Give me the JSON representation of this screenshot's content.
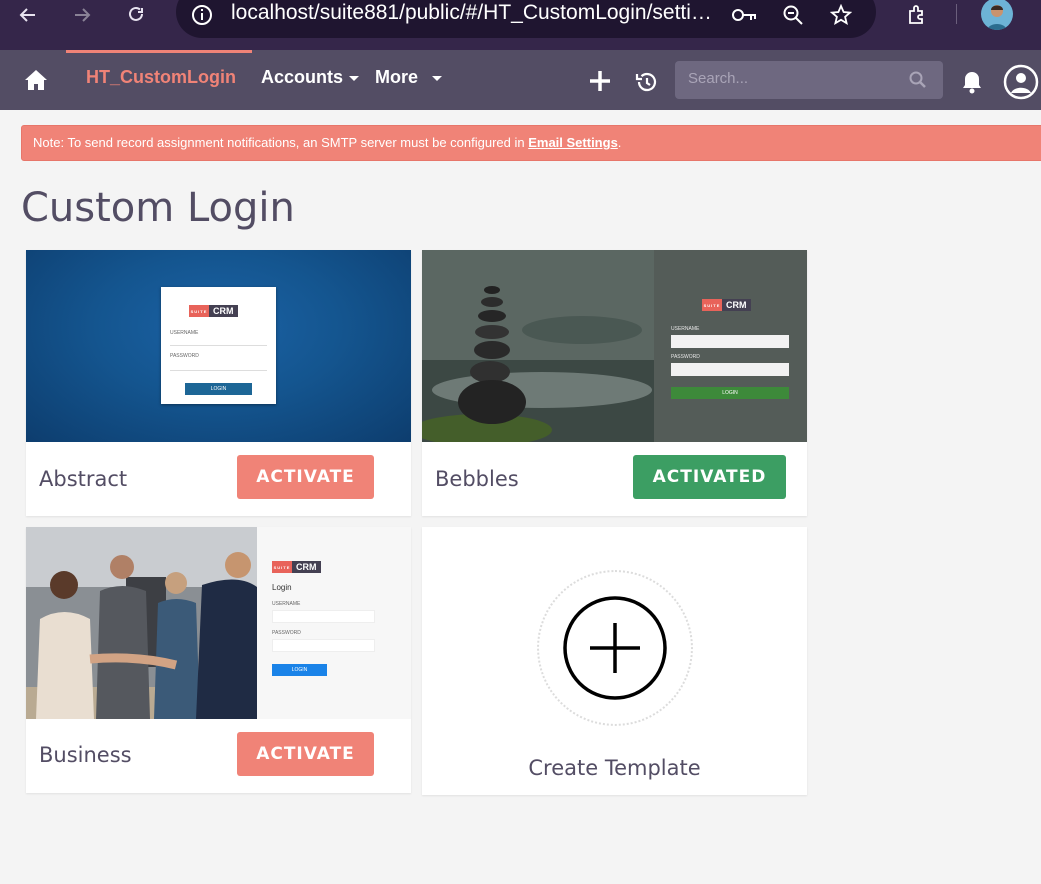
{
  "browser": {
    "url": "localhost/suite881/public/#/HT_CustomLogin/setti…",
    "icons": [
      "back-icon",
      "forward-icon",
      "reload-icon",
      "site-info-icon",
      "key-icon",
      "zoom-icon",
      "star-icon",
      "extensions-icon",
      "profile-avatar"
    ]
  },
  "nav": {
    "module_active": "HT_CustomLogin",
    "accounts": "Accounts",
    "more": "More",
    "search_placeholder": "Search..."
  },
  "notice": {
    "text_before": "Note: To send record assignment notifications, an SMTP server must be configured in ",
    "link": "Email Settings",
    "text_after": "."
  },
  "page": {
    "title": "Custom Login"
  },
  "templates": [
    {
      "name": "Abstract",
      "button": "ACTIVATE",
      "preview": {
        "logo_suite": "SUITE",
        "logo_crm": "CRM",
        "username": "USERNAME",
        "password": "PASSWORD",
        "login": "LOGIN"
      }
    },
    {
      "name": "Bebbles",
      "button": "ACTIVATED",
      "preview": {
        "logo_suite": "SUITE",
        "logo_crm": "CRM",
        "username": "USERNAME",
        "password": "PASSWORD",
        "login": "LOGIN"
      }
    },
    {
      "name": "Business",
      "button": "ACTIVATE",
      "preview": {
        "logo_suite": "SUITE",
        "logo_crm": "CRM",
        "heading": "Login",
        "username": "USERNAME",
        "password": "PASSWORD",
        "login": "LOGIN"
      }
    }
  ],
  "create_template": {
    "label": "Create Template"
  },
  "colors": {
    "brand": "#534d64",
    "accent": "#f08377",
    "activated": "#3c9e63",
    "browser_chrome": "#35264a"
  }
}
